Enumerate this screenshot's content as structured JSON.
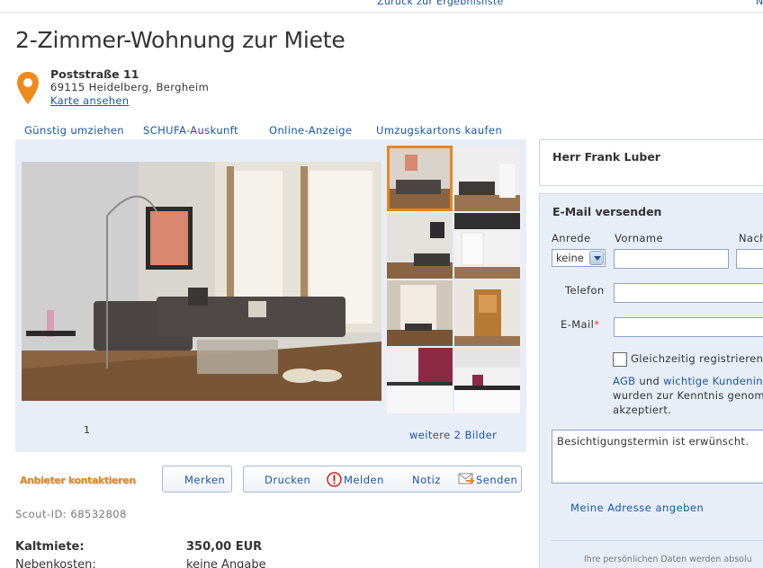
{
  "topnav": {
    "back_label": "Zurück zur Ergebnisliste",
    "next_label": "N"
  },
  "title": "2-Zimmer-Wohnung zur Miete",
  "address": {
    "street": "Poststraße 11",
    "city": "69115 Heidelberg, Bergheim",
    "map_link": "Karte ansehen"
  },
  "links": [
    "Günstig umziehen",
    "SCHUFA-Auskunft",
    "Online-Anzeige",
    "Umzugskartons kaufen"
  ],
  "gallery": {
    "page_number": "1",
    "more_pictures": "weitere 2 Bilder"
  },
  "actions": {
    "contact": "Anbieter kontaktieren",
    "remember": "Merken",
    "print": "Drucken",
    "report": "Melden",
    "note": "Notiz",
    "send": "Senden"
  },
  "scout_id": "Scout-ID: 68532808",
  "facts": [
    {
      "label": "Kaltmiete:",
      "value": "350,00 EUR"
    },
    {
      "label": "Nebenkosten:",
      "value": "keine Angabe"
    }
  ],
  "sidebar": {
    "contact_name": "Herr Frank Luber",
    "email_header": "E-Mail versenden",
    "salutation_label": "Anrede",
    "salutation_value": "keine",
    "firstname_label": "Vorname",
    "lastname_label": "Nach",
    "phone_label": "Telefon",
    "email_label": "E-Mail",
    "email_required": "*",
    "register_label": "Gleichzeitig registrieren",
    "terms_agb": "AGB",
    "terms_and": " und ",
    "terms_link": "wichtige Kundenin",
    "terms_line2": "wurden zur Kenntnis genom",
    "terms_line3": "akzeptiert.",
    "message_text": "Besichtigungstermin ist erwünscht.",
    "address_link": "Meine Adresse angeben",
    "privacy_note": "Ihre persönlichen Daten werden absolu"
  },
  "colors": {
    "accent_orange": "#e88620",
    "link_blue": "#1a56a6",
    "panel_blue": "#e8eef8"
  }
}
